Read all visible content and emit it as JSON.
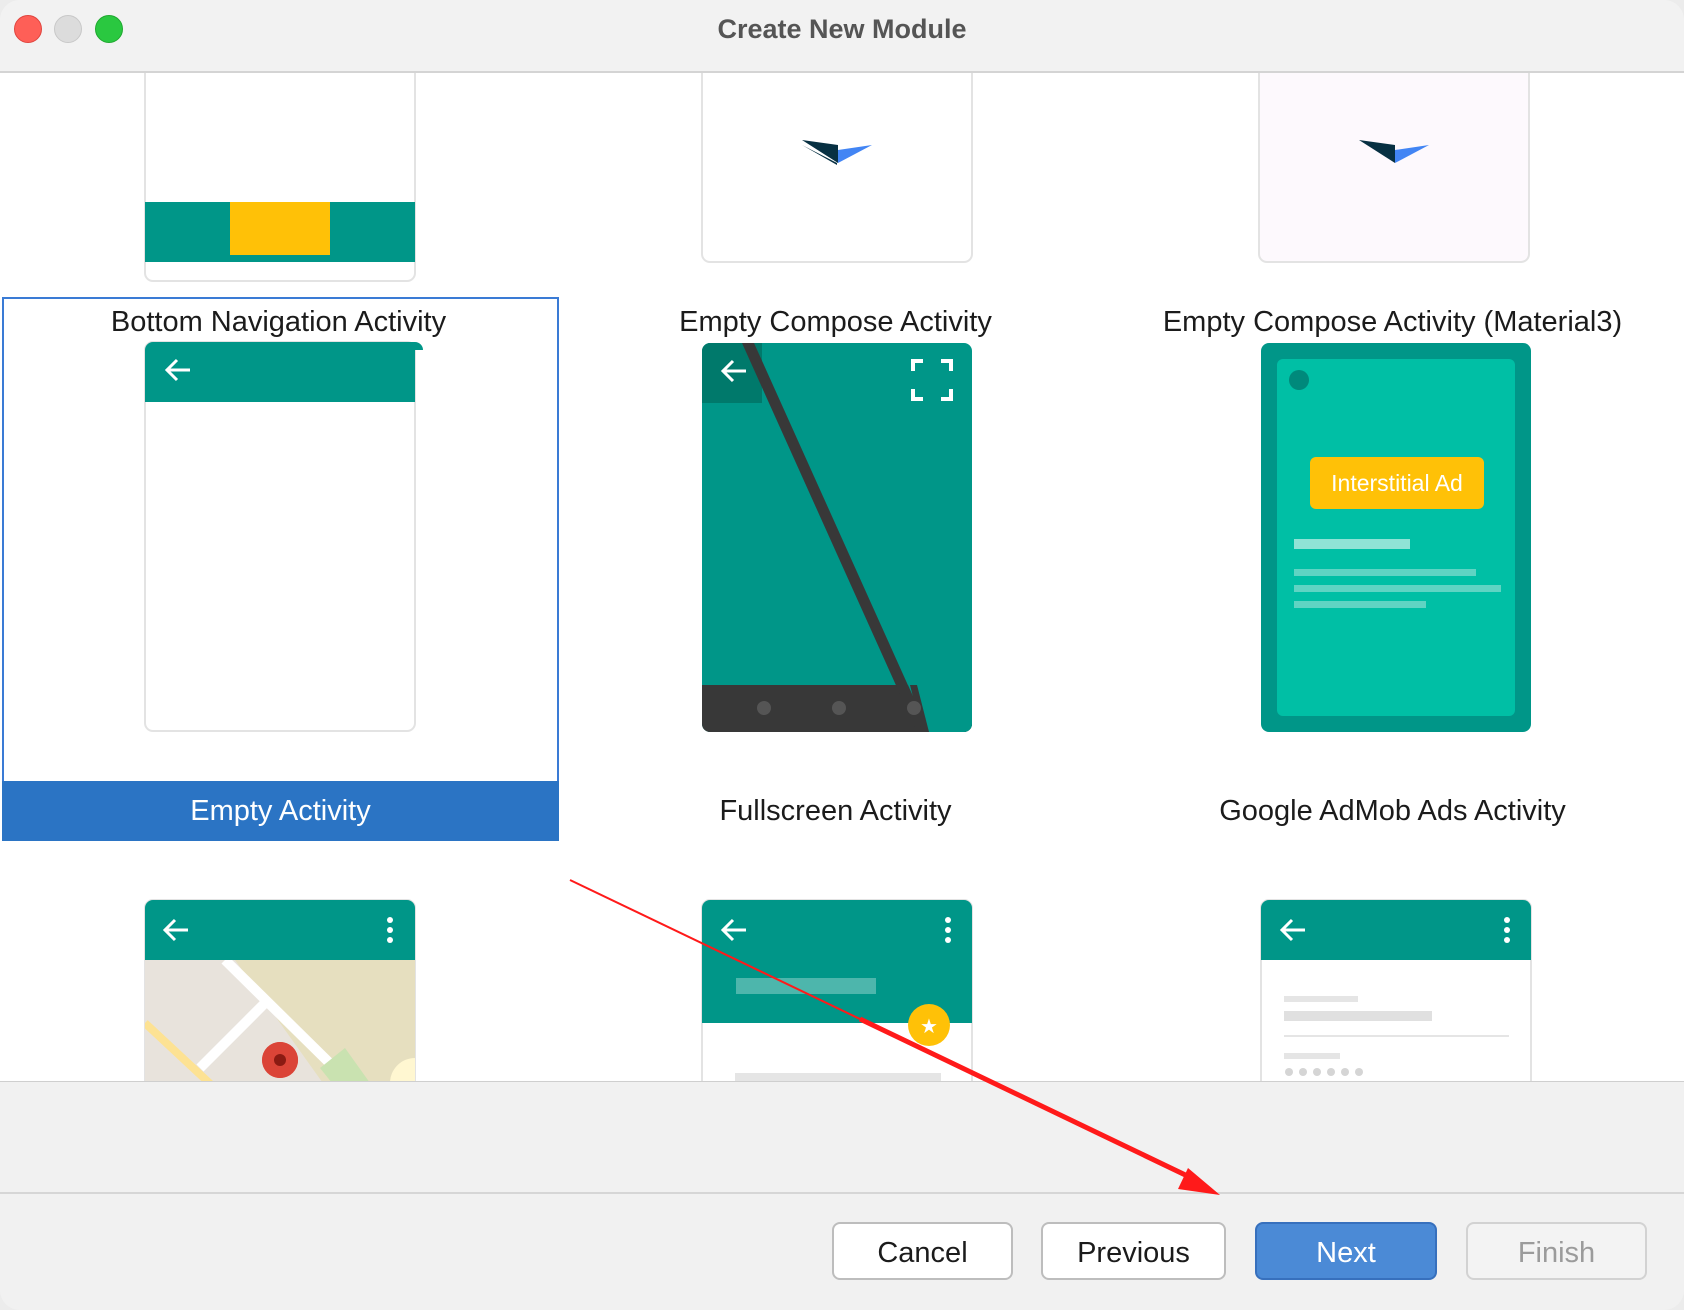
{
  "window": {
    "title": "Create New Module"
  },
  "colors": {
    "teal": "#009688",
    "amber": "#ffc107",
    "selection": "#2b74c4",
    "primary_button": "#4b8ad6",
    "annotation_arrow": "#ff0000"
  },
  "templates": [
    {
      "label": "Bottom Navigation Activity",
      "icon": "bottom-navigation-preview",
      "selected": false
    },
    {
      "label": "Empty Compose Activity",
      "icon": "compose-preview",
      "selected": false
    },
    {
      "label": "Empty Compose Activity (Material3)",
      "icon": "compose-material3-preview",
      "selected": false
    },
    {
      "label": "Empty Activity",
      "icon": "empty-activity-preview",
      "selected": true
    },
    {
      "label": "Fullscreen Activity",
      "icon": "fullscreen-preview",
      "selected": false
    },
    {
      "label": "Google AdMob Ads Activity",
      "icon": "admob-preview",
      "selected": false,
      "ad_label": "Interstitial Ad"
    },
    {
      "label": "",
      "icon": "maps-preview",
      "selected": false
    },
    {
      "label": "",
      "icon": "scrolling-preview",
      "selected": false
    },
    {
      "label": "",
      "icon": "settings-preview",
      "selected": false
    }
  ],
  "buttons": {
    "cancel": "Cancel",
    "previous": "Previous",
    "next": "Next",
    "finish": "Finish"
  }
}
